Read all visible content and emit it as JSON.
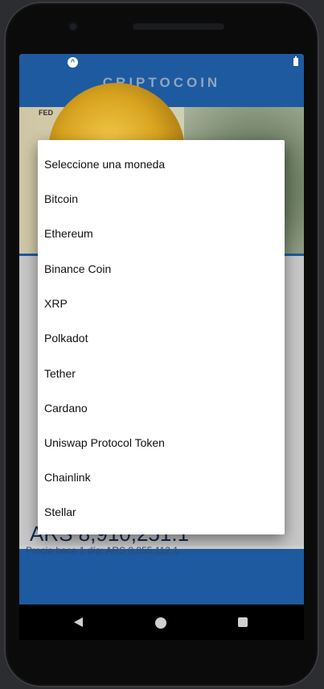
{
  "app": {
    "title": "CRIPTOCOIN",
    "banner_text": "FED"
  },
  "result": {
    "price": "ARS 8,910,251.1",
    "subtext": "Precio hace 1 día: ARS 8,855,112.1"
  },
  "picker": {
    "options": [
      "Seleccione una moneda",
      "Bitcoin",
      "Ethereum",
      "Binance Coin",
      "XRP",
      "Polkadot",
      "Tether",
      "Cardano",
      "Uniswap Protocol Token",
      "Chainlink",
      "Stellar"
    ]
  },
  "colors": {
    "header": "#1e5aa0",
    "price": "#0f2c4f"
  },
  "icons": {
    "status_left": "app-status-icon",
    "status_right": "battery-icon",
    "nav": [
      "back-icon",
      "home-icon",
      "recents-icon"
    ]
  }
}
